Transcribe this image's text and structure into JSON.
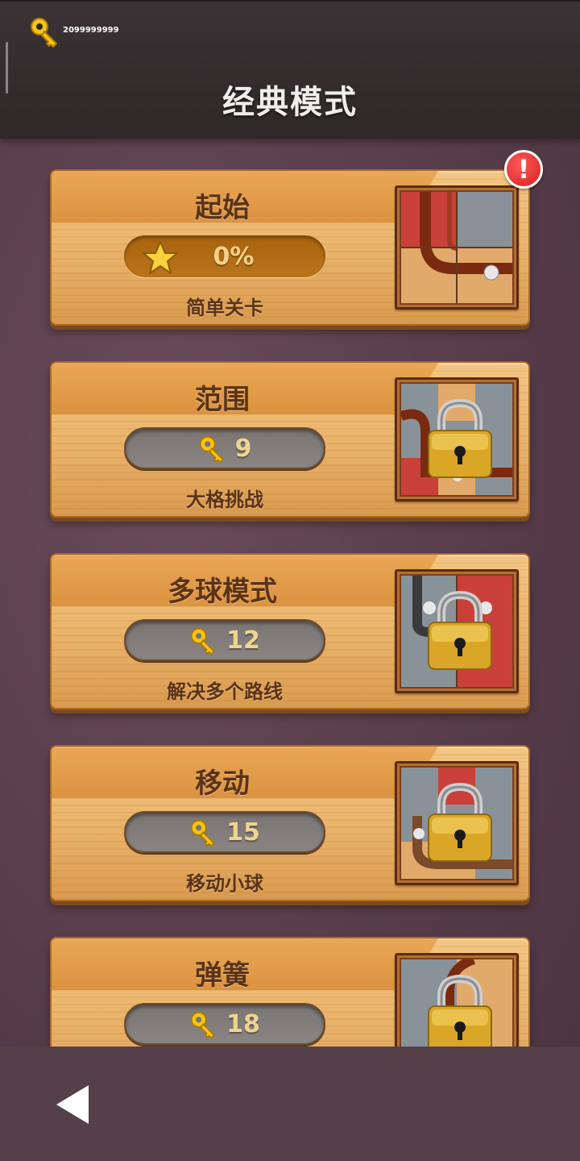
{
  "header": {
    "key_count": "2099999999",
    "title": "经典模式"
  },
  "alert": {
    "symbol": "!"
  },
  "modes": [
    {
      "title": "起始",
      "status": "progress",
      "value": "0%",
      "subtitle": "简单关卡",
      "locked": false,
      "thumb": "pipe-puzzle-red"
    },
    {
      "title": "范围",
      "status": "locked",
      "value": "9",
      "subtitle": "大格挑战",
      "locked": true,
      "thumb": "pipe-puzzle-grid"
    },
    {
      "title": "多球模式",
      "status": "locked",
      "value": "12",
      "subtitle": "解决多个路线",
      "locked": true,
      "thumb": "pipe-puzzle-multiball"
    },
    {
      "title": "移动",
      "status": "locked",
      "value": "15",
      "subtitle": "移动小球",
      "locked": true,
      "thumb": "pipe-puzzle-move"
    },
    {
      "title": "弹簧",
      "status": "locked",
      "value": "18",
      "subtitle": "",
      "locked": true,
      "thumb": "pipe-puzzle-spring"
    }
  ],
  "footer": {
    "back_icon": "back-triangle-icon"
  },
  "colors": {
    "header_bg": "#2f2829",
    "page_bg": "#5a3f4c",
    "card_wood": "#e9b26a",
    "title_brown": "#5a3317",
    "pill_gray": "#7a7473",
    "pill_brown": "#a9630e",
    "key_gold": "#f5c518",
    "alert_red": "#e02020"
  }
}
